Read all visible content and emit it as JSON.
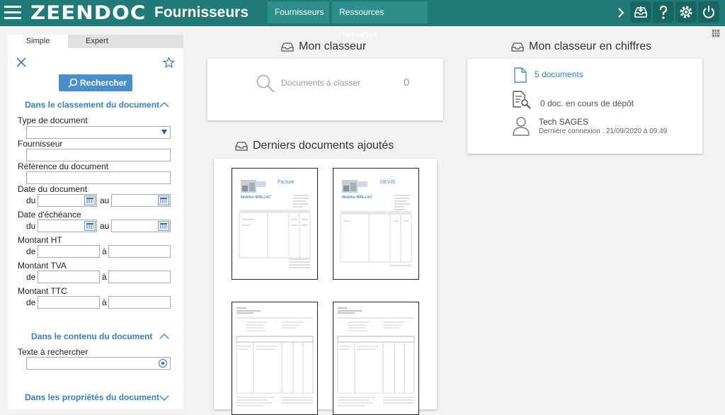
{
  "header": {
    "logo": "ZEENDOC",
    "title": "Fournisseurs",
    "tabs": [
      "Fournisseurs",
      "Ressources Humaines"
    ]
  },
  "search_panel": {
    "tabs": [
      "Simple",
      "Expert"
    ],
    "search_button": "Rechercher",
    "section_classement": "Dans le classement du document",
    "fields": {
      "type_document": "Type de document",
      "fournisseur": "Fournisseur",
      "reference": "Référence du document",
      "date_document": "Date du document",
      "date_echeance": "Date d'échéance",
      "montant_ht": "Montant HT",
      "montant_tva": "Montant TVA",
      "montant_ttc": "Montant TTC"
    },
    "range": {
      "du": "du",
      "au": "au",
      "de": "de",
      "a": "à"
    },
    "section_contenu": "Dans le contenu du document",
    "texte_label": "Texte à rechercher",
    "section_proprietes": "Dans les propriétés du document"
  },
  "classeur": {
    "title": "Mon classeur",
    "to_classify_label": "Documents à classer",
    "to_classify_count": "0"
  },
  "derniers": {
    "title": "Derniers documents ajoutés",
    "docs": [
      {
        "heading": "Facture",
        "company": "Mobilier BRILLAC"
      },
      {
        "heading": "DEVIS",
        "company": "Mobilier BRILLAC"
      }
    ]
  },
  "chiffres": {
    "title": "Mon classeur en chiffres",
    "documents": "5 documents",
    "depot": "0 doc. en cours de dépôt",
    "user_name": "Tech SAGES",
    "last_login": "Dernière connexion : 21/09/2020 à 09:49"
  },
  "colors": {
    "header": "#1f7a78",
    "accent": "#3a7fc1",
    "button": "#4a8fcb"
  },
  "icons": [
    "menu-icon",
    "chevron-right-icon",
    "inbox-icon",
    "help-icon",
    "settings-icon",
    "power-icon",
    "grid-icon",
    "close-icon",
    "star-icon",
    "search-icon",
    "tray-icon",
    "document-icon",
    "document-search-icon",
    "user-icon",
    "target-icon"
  ]
}
